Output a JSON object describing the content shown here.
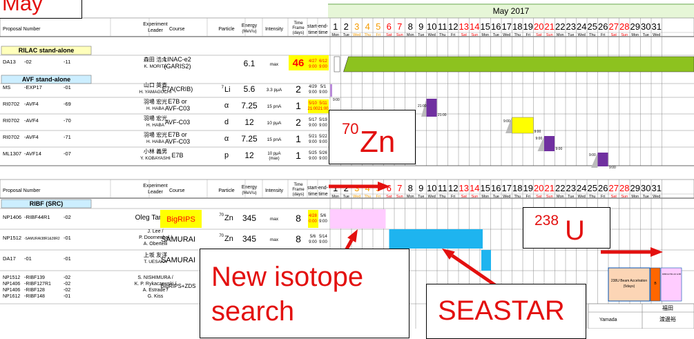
{
  "callouts": {
    "month": "May",
    "zn_base": "Zn",
    "zn_mass": "70",
    "u_base": "U",
    "u_mass": "238",
    "new_isotope_line1": "New isotope",
    "new_isotope_line2": "search",
    "seastar": "SEASTAR"
  },
  "calendar": {
    "month_year": "May 2017",
    "days": [
      "1",
      "2",
      "3",
      "4",
      "5",
      "6",
      "7",
      "8",
      "9",
      "10",
      "11",
      "12",
      "13",
      "14",
      "15",
      "16",
      "17",
      "18",
      "19",
      "20",
      "21",
      "22",
      "23",
      "24",
      "25",
      "26",
      "27",
      "28",
      "29",
      "30",
      "31"
    ],
    "weekdays": [
      "Mon",
      "Tue",
      "Wed",
      "Thu",
      "Fri",
      "Sat",
      "Sun",
      "Mon",
      "Tue",
      "Wed",
      "Thu",
      "Fri",
      "Sat",
      "Sun",
      "Mon",
      "Tue",
      "Wed",
      "Thu",
      "Fri",
      "Sat",
      "Sun",
      "Mon",
      "Tue",
      "Wed",
      "Thu",
      "Fri",
      "Sat",
      "Sun",
      "Mon",
      "Tue",
      "Wed"
    ],
    "weekend_days": [
      6,
      7,
      13,
      14,
      20,
      21,
      27,
      28
    ],
    "holidays": [
      3,
      4,
      5
    ]
  },
  "table1": {
    "headers": {
      "proposal": "Proposal Number",
      "leader": "Experiment Leader",
      "course": "Course",
      "particle": "Particle",
      "energy": "Energy (MeV/u)",
      "intensity": "Intensity",
      "timeframe": "Time Frame (days)",
      "start": "start- time",
      "end": "end- time"
    },
    "section_rilac": "RILAC stand-alone",
    "section_avf": "AVF stand-alone",
    "rows": [
      {
        "p1": "DA13",
        "p2": "-02",
        "p3": "-11",
        "leader_jp": "森田 浩介",
        "leader_en": "K. MORITA",
        "course1": "LINAC-e2",
        "course2": "(GARIS2)",
        "particle": "",
        "energy": "6.1",
        "intensity": "max",
        "days": "46",
        "start_d": "4/27",
        "start_t": "9:00",
        "end_d": "6/12",
        "end_t": "9:00"
      },
      {
        "p1": "MS",
        "p2": "-EXP17",
        "p3": "-01",
        "leader_jp": "山口 英斉",
        "leader_en": "H. YAMAGUCHI",
        "course1": "E7A(CRIB)",
        "course2": "",
        "particle": "7Li",
        "energy": "5.6",
        "intensity": "3.3 pμA",
        "days": "2",
        "start_d": "4/29",
        "start_t": "9:00",
        "end_d": "5/1",
        "end_t": "9:00"
      },
      {
        "p1": "RI0702",
        "p2": "-AVF4",
        "p3": "-69",
        "leader_jp": "羽場 宏光",
        "leader_en": "H. HABA",
        "course1": "E7B or",
        "course2": "AVF-C03",
        "particle": "α",
        "energy": "7.25",
        "intensity": "15 pnA",
        "days": "1",
        "start_d": "5/10",
        "start_t": "21:00",
        "end_d": "5/11",
        "end_t": "21:00"
      },
      {
        "p1": "RI0702",
        "p2": "-AVF4",
        "p3": "-70",
        "leader_jp": "羽場 宏光",
        "leader_en": "H. HABA",
        "course1": "AVF-C03",
        "course2": "",
        "particle": "d",
        "energy": "12",
        "intensity": "10 pμA",
        "days": "2",
        "start_d": "5/17",
        "start_t": "9:00",
        "end_d": "5/19",
        "end_t": "9:00"
      },
      {
        "p1": "RI0702",
        "p2": "-AVF4",
        "p3": "-71",
        "leader_jp": "羽場 宏光",
        "leader_en": "H. HABA",
        "course1": "E7B or",
        "course2": "AVF-C03",
        "particle": "α",
        "energy": "7.25",
        "intensity": "15 pnA",
        "days": "1",
        "start_d": "5/21",
        "start_t": "9:00",
        "end_d": "5/22",
        "end_t": "9:00"
      },
      {
        "p1": "ML1307",
        "p2": "-AVF14",
        "p3": "-07",
        "leader_jp": "小林 義男",
        "leader_en": "Y. KOBAYASHI",
        "course1": "E7B",
        "course2": "",
        "particle": "p",
        "energy": "12",
        "intensity": "10 pμA (max)",
        "days": "1",
        "start_d": "5/25",
        "start_t": "9:00",
        "end_d": "5/26",
        "end_t": "9:00"
      }
    ],
    "bar_labels": {
      "first": "9:00",
      "a1": "21:00",
      "a2": "21:00",
      "b1": "9:00",
      "b2": "9:00",
      "c1": "9:00",
      "c2": "9:00",
      "d1": "9:00",
      "d2": "9:00"
    }
  },
  "table2": {
    "headers": {
      "proposal": "Proposal Number",
      "leader": "Experiment Leader",
      "course": "Course",
      "particle": "Particle",
      "energy": "Energy (MeV/u)",
      "intensity": "Intensity",
      "timeframe": "Time Frame (days)",
      "start": "start- time",
      "end": "end- time"
    },
    "section": "RIBF (SRC)",
    "rows": [
      {
        "p1": "NP1406",
        "p2": "-RIBF44R1",
        "p3": "-02",
        "leader": "Oleg Tarasov",
        "course": "BigRIPS",
        "particle": "70Zn",
        "energy": "345",
        "intensity": "max",
        "days": "8",
        "start_d": "4/28",
        "start_t": "0:00",
        "end_d": "5/6",
        "end_t": "9:00"
      },
      {
        "p1": "NP1512",
        "p2": "-SAMURAI38R1&39R2",
        "p3": "-01",
        "leader": "J. Lee / P. Doornenbal / A. Obertelli",
        "course": "SAMURAI",
        "particle": "70Zn",
        "energy": "345",
        "intensity": "max",
        "days": "8",
        "start_d": "5/6",
        "start_t": "9:00",
        "end_d": "5/14",
        "end_t": "9:00"
      },
      {
        "p1": "DA17",
        "p2": "-01",
        "p3": "-01",
        "leader_jp": "上坂 友洋",
        "leader_en": "T. UESAKA",
        "course": "SAMURAI"
      },
      {
        "p1": "NP1512 / NP1406 / NP1406 / NP1612",
        "p2": "-RIBF139 / -RIBF127R1 / -RIBF128 / -RIBF148",
        "p3": "-02 / -02 / -02 / -01",
        "leader": "S. NISHIMURA / K. P. Rykaczewski / A. Estrade / G. Kiss",
        "course": "BigRIPS+ZDS"
      }
    ],
    "u_beam_box": "238U Beam Accelration (5days)",
    "small_box_text": "B T e",
    "tiny_box_text": "RIBF127R1-02 & 88"
  },
  "footer": {
    "name_jp": "福田",
    "name_en": "Yamada",
    "name2_jp": "渡邊裕"
  },
  "colors": {
    "calendar_header": "#e6f6d7",
    "calendar_border": "#6aa84f",
    "rilac_bar": "#8dc21f",
    "avf_purple": "#7030a0",
    "avf_yellow": "#ffff00",
    "pink_bar": "#ffccff",
    "cyan_bar": "#1eb4ef",
    "orange_box": "#fcd5b5",
    "red_box": "#ff6600",
    "callout_red": "#e3100f",
    "arrow_red": "#e3100f"
  }
}
